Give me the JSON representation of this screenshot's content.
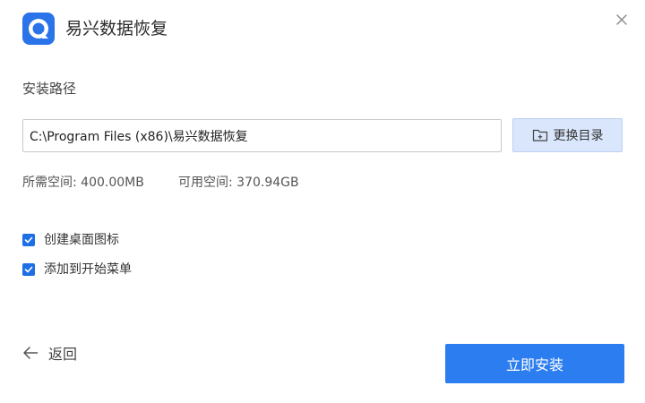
{
  "window": {
    "title": "易兴数据恢复",
    "logo_icon": "app-logo-icon",
    "close_icon": "close-icon"
  },
  "install": {
    "section_label": "安装路径",
    "path_value": "C:\\Program Files (x86)\\易兴数据恢复",
    "browse_label": "更换目录",
    "browse_icon": "folder-icon",
    "space_required": "所需空间: 400.00MB",
    "space_available": "可用空间: 370.94GB"
  },
  "options": [
    {
      "label": "创建桌面图标",
      "checked": true
    },
    {
      "label": "添加到开始菜单",
      "checked": true
    }
  ],
  "footer": {
    "back_label": "返回",
    "back_icon": "arrow-left-icon",
    "install_label": "立即安装"
  },
  "colors": {
    "accent": "#2c7ef0",
    "checkbox": "#1d6fe5",
    "browse_bg": "#d9e6fb"
  }
}
